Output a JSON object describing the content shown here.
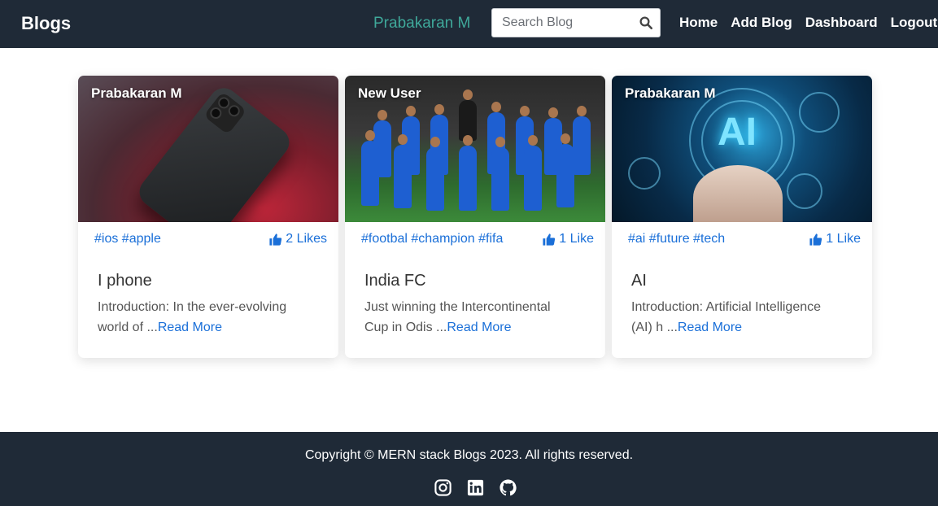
{
  "navbar": {
    "brand": "Blogs",
    "user_name": "Prabakaran M",
    "search_placeholder": "Search Blog",
    "links": [
      "Home",
      "Add Blog",
      "Dashboard",
      "Logout"
    ]
  },
  "cards": [
    {
      "author": "Prabakaran M",
      "tags": "#ios #apple",
      "likes": "2 Likes",
      "title": "I phone",
      "excerpt": "Introduction: In the ever-evolving world of ...",
      "read_more": "Read More",
      "image": "iphone-photo"
    },
    {
      "author": "New User",
      "tags": "#footbal #champion #fifa",
      "likes": "1 Like",
      "title": "India FC",
      "excerpt": "Just winning the Intercontinental Cup in Odis ...",
      "read_more": "Read More",
      "image": "football-team-photo"
    },
    {
      "author": "Prabakaran M",
      "tags": "#ai #future #tech",
      "likes": "1 Like",
      "title": "AI",
      "excerpt": "Introduction: Artificial Intelligence (AI) h ...",
      "read_more": "Read More",
      "image": "ai-hand-photo"
    }
  ],
  "footer": {
    "copyright": "Copyright © MERN stack Blogs 2023. All rights reserved.",
    "social": [
      "instagram-icon",
      "linkedin-icon",
      "github-icon"
    ]
  },
  "colors": {
    "navbar_bg": "#1f2a37",
    "accent_teal": "#3fa89a",
    "link_blue": "#1a6fd8"
  }
}
